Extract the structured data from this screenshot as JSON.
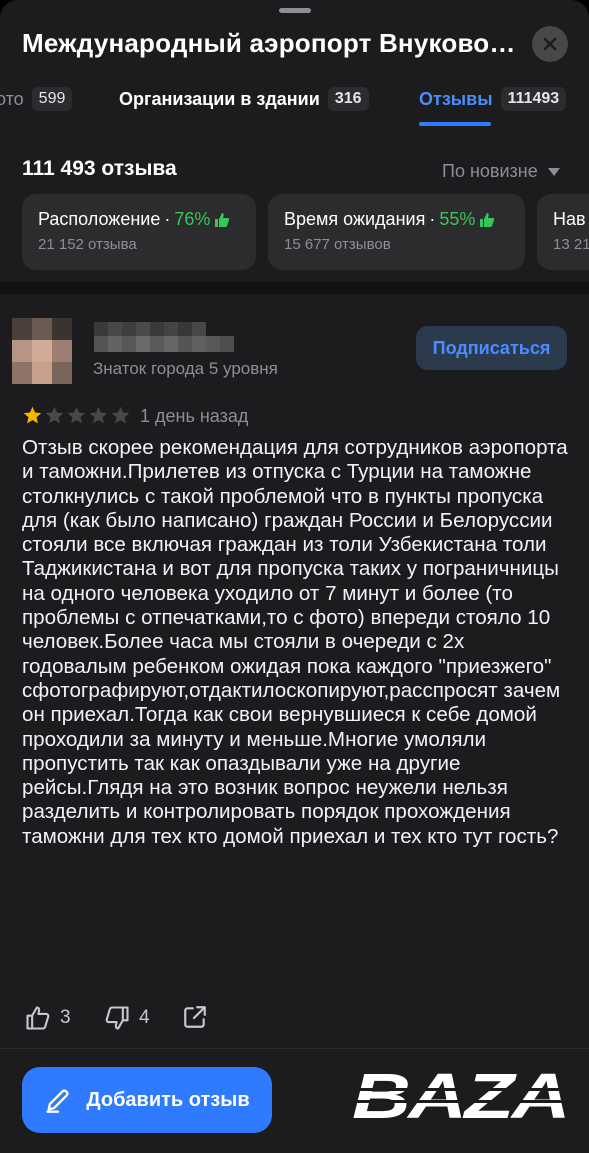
{
  "header": {
    "title": "Международный аэропорт Внуково…"
  },
  "tabs": [
    {
      "label": "ото",
      "count": "599"
    },
    {
      "label": "Организации в здании",
      "count": "316"
    },
    {
      "label": "Отзывы",
      "count": "111493"
    }
  ],
  "summary": {
    "count": "111 493 отзыва",
    "sort_label": "По новизне"
  },
  "aspects": [
    {
      "name": "Расположение",
      "dot": " · ",
      "percent": "76%",
      "reviews": "21 152 отзыва"
    },
    {
      "name": "Время ожидания",
      "dot": " · ",
      "percent": "55%",
      "reviews": "15 677 отзывов"
    },
    {
      "name": "Нав",
      "dot": "",
      "percent": "",
      "reviews": "13 21"
    }
  ],
  "review": {
    "level": "Знаток города 5 уровня",
    "subscribe_label": "Подписаться",
    "rating": 1,
    "rating_max": 5,
    "date": "1 день назад",
    "text": "Отзыв скорее рекомендация для сотрудников аэропорта и таможни.Прилетев из отпуска с Турции на таможне столкнулись с такой проблемой что в пункты пропуска для (как было написано) граждан России и Белоруссии стояли все включая граждан из толи Узбекистана толи Таджикистана и вот для пропуска таких у пограничницы на одного человека уходило от 7 минут и более (то проблемы с отпечатками,то с фото) впереди стояло 10 человек.Более часа мы стояли в очереди с 2х годовалым ребенком ожидая пока каждого \"приезжего\" сфотографируют,отдактилоскопируют,расспросят зачем он приехал.Тогда как свои вернувшиеся к себе домой проходили за минуту и меньше.Многие умоляли пропустить так как опаздывали уже на другие рейсы.Глядя на это возник вопрос неужели нельзя разделить и контролировать порядок прохождения таможни для тех кто домой приехал и тех кто тут гость?",
    "likes": "3",
    "dislikes": "4"
  },
  "add_review_label": "Добавить отзыв",
  "watermark": "BAZA",
  "colors": {
    "accent": "#2f7bff",
    "positive": "#34c759",
    "star": "#f5b600",
    "background": "#1c1c1e"
  },
  "icons": [
    "close-icon",
    "caret-down-icon",
    "thumbs-up-icon",
    "thumbs-down-icon",
    "share-icon",
    "pencil-icon",
    "star-icon"
  ]
}
